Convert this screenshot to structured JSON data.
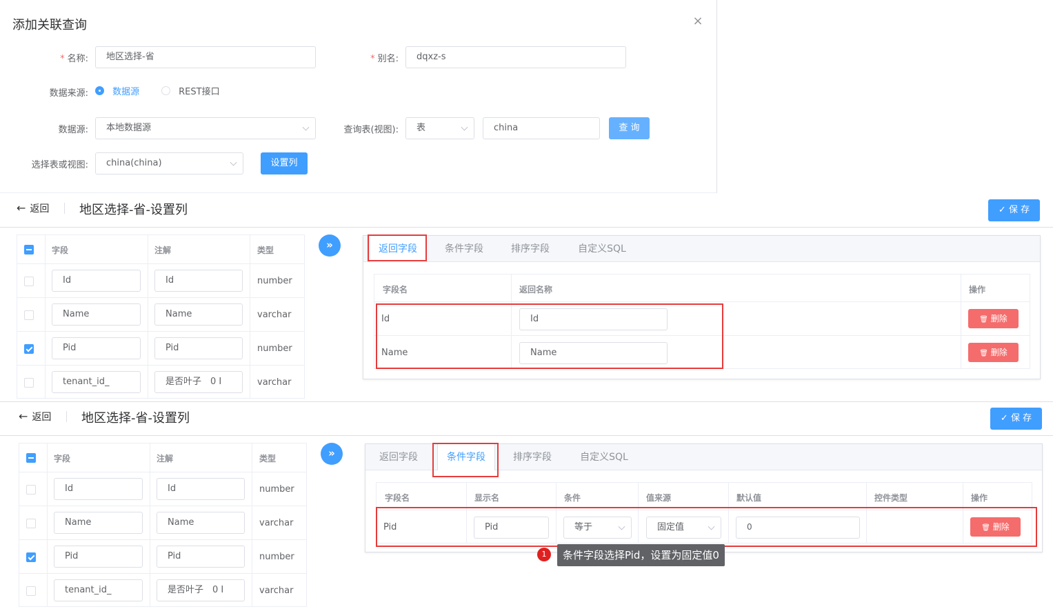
{
  "dialog": {
    "title": "添加关联查询",
    "close": "×",
    "name_label": "名称:",
    "name_value": "地区选择-省",
    "alias_label": "别名:",
    "alias_value": "dqxz-s",
    "required_mark": "*",
    "source_label": "数据来源:",
    "source_opt1": "数据源",
    "source_opt2": "REST接口",
    "datasource_label": "数据源:",
    "datasource_value": "本地数据源",
    "query_table_label": "查询表(视图):",
    "query_type_value": "表",
    "query_input_value": "china",
    "query_button": "查 询",
    "select_table_label": "选择表或视图:",
    "select_table_value": "china(china)",
    "set_columns_button": "设置列"
  },
  "header": {
    "back": "返回",
    "back_icon": "←",
    "title": "地区选择-省-设置列",
    "save": "保 存",
    "save_icon": "✓"
  },
  "left_table": {
    "headers": [
      "字段",
      "注解",
      "类型"
    ],
    "rows": [
      {
        "field": "Id",
        "note": "Id",
        "type": "number",
        "checked": false
      },
      {
        "field": "Name",
        "note": "Name",
        "type": "varchar",
        "checked": false
      },
      {
        "field": "Pid",
        "note": "Pid",
        "type": "number",
        "checked": true
      },
      {
        "field": "tenant_id_",
        "note": "是否叶子　0 I",
        "type": "varchar",
        "checked": false
      }
    ]
  },
  "transfer_icon": "»",
  "tabs": [
    "返回字段",
    "条件字段",
    "排序字段",
    "自定义SQL"
  ],
  "return_table": {
    "headers": [
      "字段名",
      "返回名称",
      "操作"
    ],
    "rows": [
      {
        "field": "Id",
        "name": "Id"
      },
      {
        "field": "Name",
        "name": "Name"
      }
    ],
    "delete": "删除",
    "delete_icon": "🗑"
  },
  "cond_table": {
    "headers": [
      "字段名",
      "显示名",
      "条件",
      "值来源",
      "默认值",
      "控件类型",
      "操作"
    ],
    "row": {
      "field": "Pid",
      "display": "Pid",
      "cond": "等于",
      "source": "固定值",
      "default": "0"
    },
    "delete": "删除"
  },
  "annotation": {
    "badge": "1",
    "text": "条件字段选择Pid，设置为固定值0"
  },
  "colors": {
    "primary": "#409eff",
    "danger": "#f56c6c",
    "highlight": "#e63b3b"
  }
}
